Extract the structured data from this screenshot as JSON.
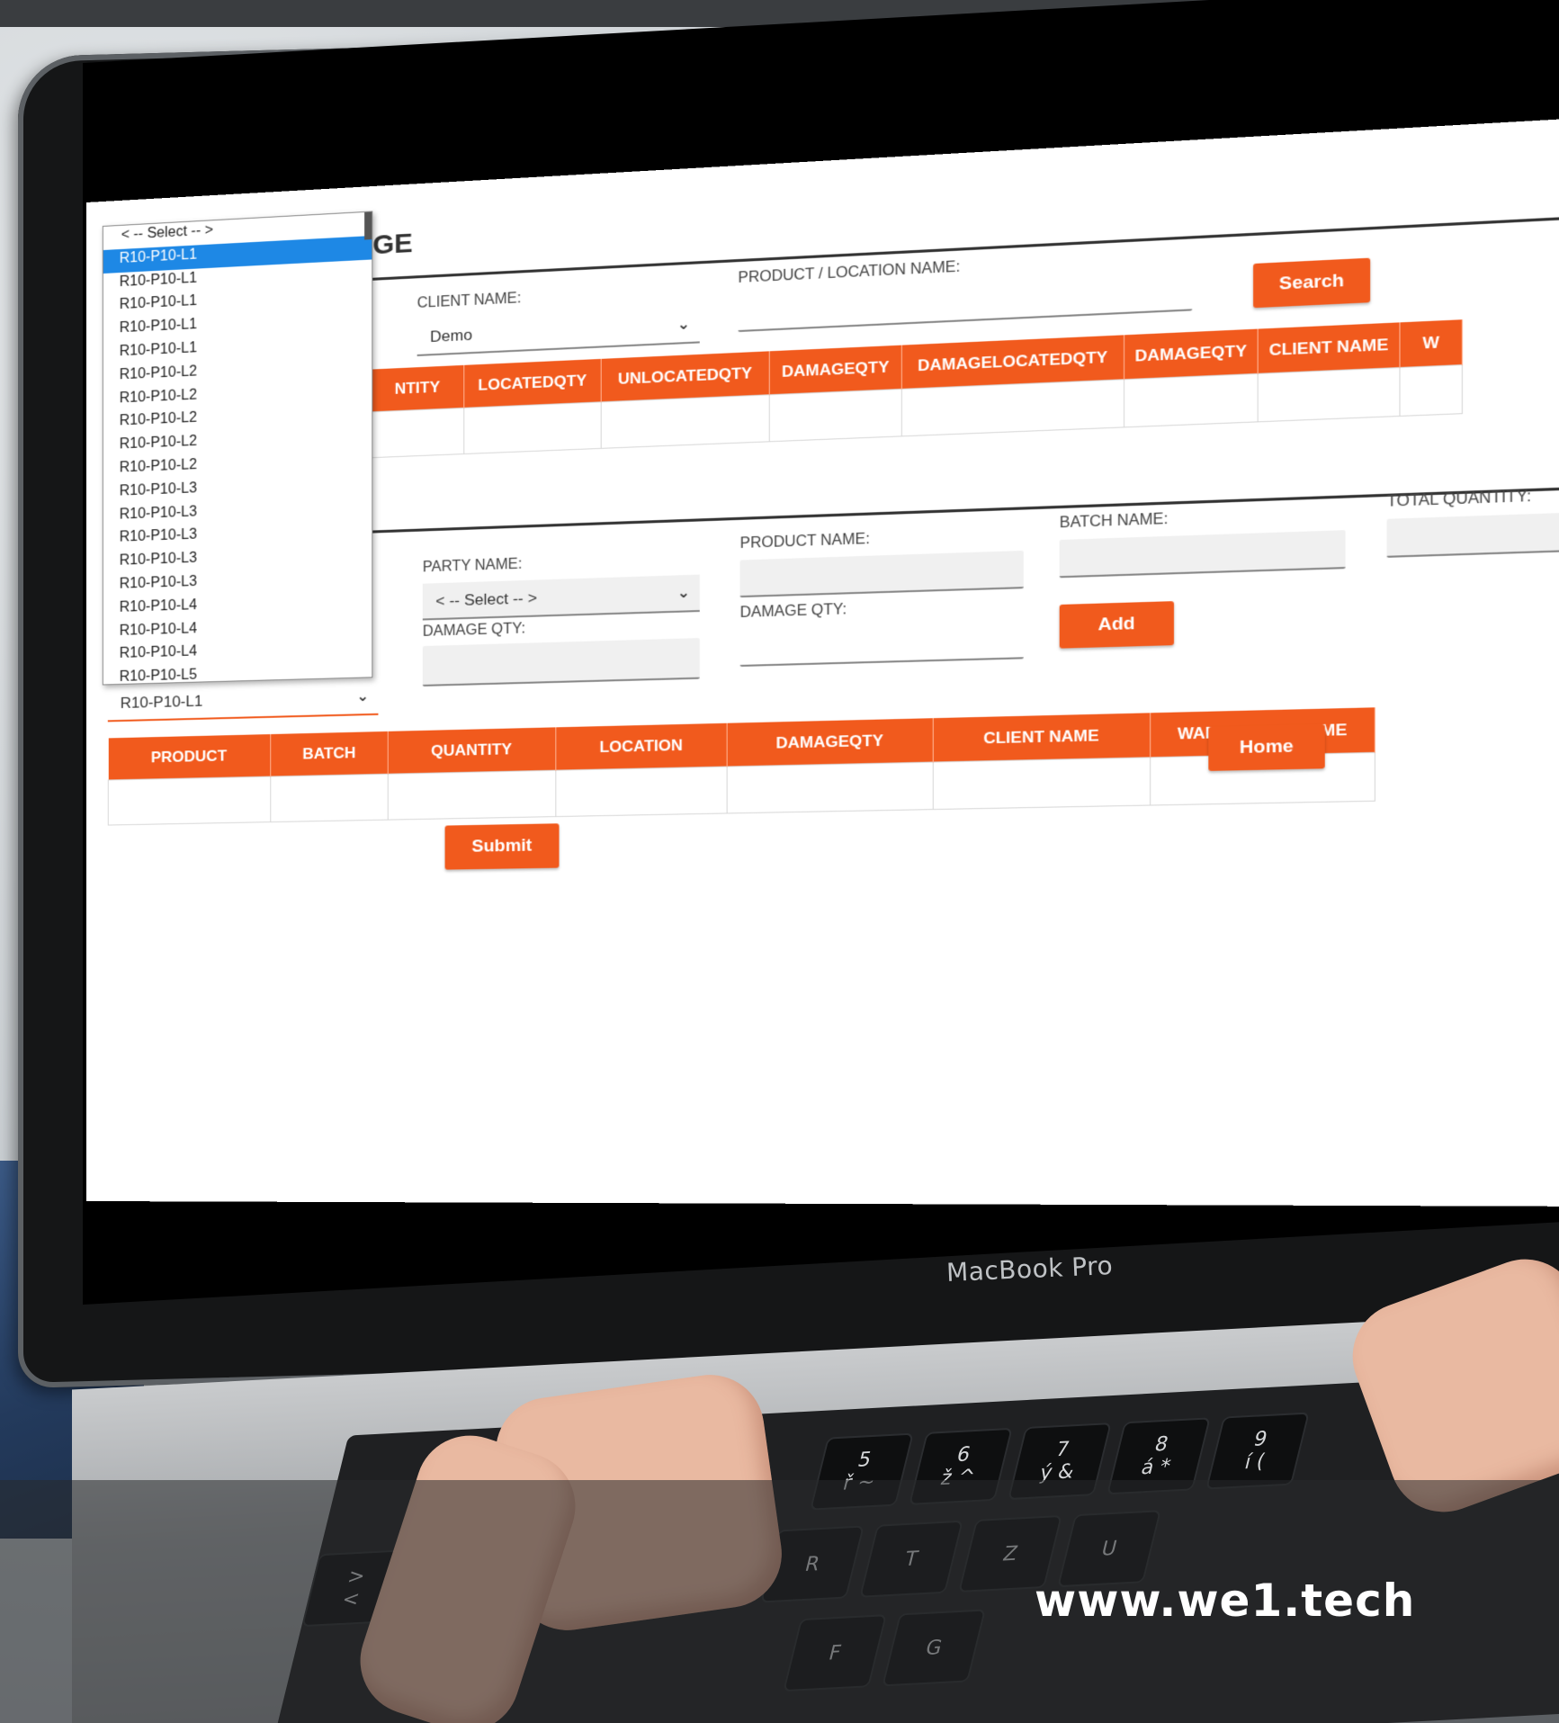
{
  "page": {
    "title_fragment": "GE",
    "brand": "MacBook Pro",
    "watermark": "www.we1.tech"
  },
  "search": {
    "client_label": "CLIENT NAME:",
    "client_value": "Demo",
    "product_label": "PRODUCT / LOCATION NAME:",
    "product_value": "",
    "search_button": "Search"
  },
  "top_table": {
    "headers": [
      "NTITY",
      "LOCATEDQTY",
      "UNLOCATEDQTY",
      "DAMAGEQTY",
      "DAMAGELOCATEDQTY",
      "DAMAGEQTY",
      "CLIENT NAME",
      "W"
    ]
  },
  "entry": {
    "party_label": "PARTY NAME:",
    "party_value": "< -- Select -- >",
    "product_label": "PRODUCT NAME:",
    "batch_label": "BATCH NAME:",
    "total_label": "TOTAL QUANTITY:",
    "damage_label_1": "DAMAGE QTY:",
    "damage_label_2": "DAMAGE QTY:",
    "add_button": "Add",
    "location_value": "R10-P10-L1"
  },
  "dropdown": {
    "options": [
      "< -- Select -- >",
      "R10-P10-L1",
      "R10-P10-L1",
      "R10-P10-L1",
      "R10-P10-L1",
      "R10-P10-L1",
      "R10-P10-L2",
      "R10-P10-L2",
      "R10-P10-L2",
      "R10-P10-L2",
      "R10-P10-L2",
      "R10-P10-L3",
      "R10-P10-L3",
      "R10-P10-L3",
      "R10-P10-L3",
      "R10-P10-L3",
      "R10-P10-L4",
      "R10-P10-L4",
      "R10-P10-L4",
      "R10-P10-L5"
    ],
    "selected_index": 1
  },
  "bottom_table": {
    "headers": [
      "PRODUCT",
      "BATCH",
      "QUANTITY",
      "LOCATION",
      "DAMAGEQTY",
      "CLIENT NAME",
      "WAREHOUSE NAME"
    ]
  },
  "actions": {
    "home_button": "Home",
    "submit_button": "Submit"
  },
  "keyboard": {
    "keys": [
      "5\nř ~",
      "6\nž ^",
      "7\ný &",
      "8\ná *",
      "9\ní (",
      "T",
      "Z",
      "U",
      "R",
      "F",
      "G",
      ">\n<"
    ]
  },
  "colors": {
    "accent": "#f15a1d",
    "selection": "#1e88e5"
  }
}
